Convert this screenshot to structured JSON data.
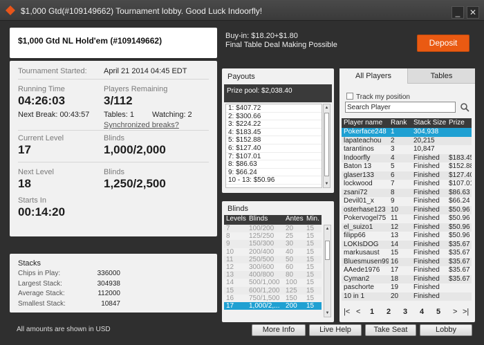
{
  "window": {
    "title": "$1,000 Gtd(#109149662) Tournament lobby. Good Luck Indoorfly!",
    "minimize_label": "_",
    "close_label": "✕"
  },
  "header": {
    "tournament_name": "$1,000 Gtd NL Hold'em (#109149662)",
    "buyin": "Buy-in: $18.20+$1.80",
    "deal_note": "Final Table Deal Making Possible",
    "deposit_label": "Deposit"
  },
  "info": {
    "started_label": "Tournament Started:",
    "started_value": "April 21 2014  04:45 EDT",
    "running_label": "Running Time",
    "running_value": "04:26:03",
    "remaining_label": "Players Remaining",
    "remaining_value": "3/112",
    "next_break": "Next Break: 00:43:57",
    "tables": "Tables: 1",
    "watching": "Watching: 2",
    "sync_breaks": "Synchronized breaks?",
    "current_level_label": "Current Level",
    "current_level_value": "17",
    "blinds_label": "Blinds",
    "current_blinds": "1,000/2,000",
    "next_level_label": "Next Level",
    "next_level_value": "18",
    "next_blinds_label": "Blinds",
    "next_blinds": "1,250/2,500",
    "starts_in_label": "Starts In",
    "starts_in_value": "00:14:20"
  },
  "stacks": {
    "title": "Stacks",
    "rows": [
      {
        "label": "Chips in Play:",
        "value": "336000"
      },
      {
        "label": "Largest Stack:",
        "value": "304938"
      },
      {
        "label": "Average Stack:",
        "value": "112000"
      },
      {
        "label": "Smallest Stack:",
        "value": "10847"
      }
    ]
  },
  "footnote": "All amounts are shown in USD",
  "payouts": {
    "title": "Payouts",
    "prize_pool": "Prize pool: $2,038.40",
    "rows": [
      "1: $407.72",
      "2: $300.66",
      "3: $224.22",
      "4: $183.45",
      "5: $152.88",
      "6: $127.40",
      "7: $107.01",
      "8: $86.63",
      "9: $66.24",
      "10 - 13: $50.96"
    ]
  },
  "blinds": {
    "title": "Blinds",
    "headers": [
      "Levels",
      "Blinds",
      "Antes",
      "Min."
    ],
    "rows": [
      [
        "7",
        "100/200",
        "20",
        "15"
      ],
      [
        "8",
        "125/250",
        "25",
        "15"
      ],
      [
        "9",
        "150/300",
        "30",
        "15"
      ],
      [
        "10",
        "200/400",
        "40",
        "15"
      ],
      [
        "11",
        "250/500",
        "50",
        "15"
      ],
      [
        "12",
        "300/600",
        "60",
        "15"
      ],
      [
        "13",
        "400/800",
        "80",
        "15"
      ],
      [
        "14",
        "500/1,000",
        "100",
        "15"
      ],
      [
        "15",
        "600/1,200",
        "125",
        "15"
      ],
      [
        "16",
        "750/1,500",
        "150",
        "15"
      ],
      [
        "17",
        "1,000/2,...",
        "200",
        "15"
      ]
    ]
  },
  "players": {
    "tab_all": "All Players",
    "tab_tables": "Tables",
    "track_label": "Track my position",
    "search_value": "Search Player",
    "headers": [
      "Player name",
      "Rank",
      "Stack Size",
      "Prize"
    ],
    "rows": [
      [
        "Pokerface248",
        "1",
        "304,938",
        ""
      ],
      [
        "lapateachou",
        "2",
        "20,215",
        ""
      ],
      [
        "tarantinos",
        "3",
        "10,847",
        ""
      ],
      [
        "Indoorfly",
        "4",
        "Finished",
        "$183.45"
      ],
      [
        "Baton 13",
        "5",
        "Finished",
        "$152.88"
      ],
      [
        "glaser133",
        "6",
        "Finished",
        "$127.40"
      ],
      [
        "lockwood",
        "7",
        "Finished",
        "$107.01"
      ],
      [
        "zsani72",
        "8",
        "Finished",
        "$86.63"
      ],
      [
        "Devil01_x",
        "9",
        "Finished",
        "$66.24"
      ],
      [
        "osterhase123",
        "10",
        "Finished",
        "$50.96"
      ],
      [
        "Pokervogel75",
        "11",
        "Finished",
        "$50.96"
      ],
      [
        "el_suizo1",
        "12",
        "Finished",
        "$50.96"
      ],
      [
        "filipp66",
        "13",
        "Finished",
        "$50.96"
      ],
      [
        "LOKIsDOG",
        "14",
        "Finished",
        "$35.67"
      ],
      [
        "markusaust",
        "15",
        "Finished",
        "$35.67"
      ],
      [
        "Bluesmusen99",
        "16",
        "Finished",
        "$35.67"
      ],
      [
        "AAede1976",
        "17",
        "Finished",
        "$35.67"
      ],
      [
        "Cyman2",
        "18",
        "Finished",
        "$35.67"
      ],
      [
        "paschorte",
        "19",
        "Finished",
        ""
      ],
      [
        "10 in 1",
        "20",
        "Finished",
        ""
      ]
    ],
    "pager": {
      "first": "|<",
      "prev": "<",
      "p1": "1",
      "p2": "2",
      "p3": "3",
      "p4": "4",
      "p5": "5",
      "next": ">",
      "last": ">|"
    }
  },
  "buttons": {
    "more_info": "More Info",
    "live_help": "Live Help",
    "take_seat": "Take Seat",
    "lobby": "Lobby"
  }
}
